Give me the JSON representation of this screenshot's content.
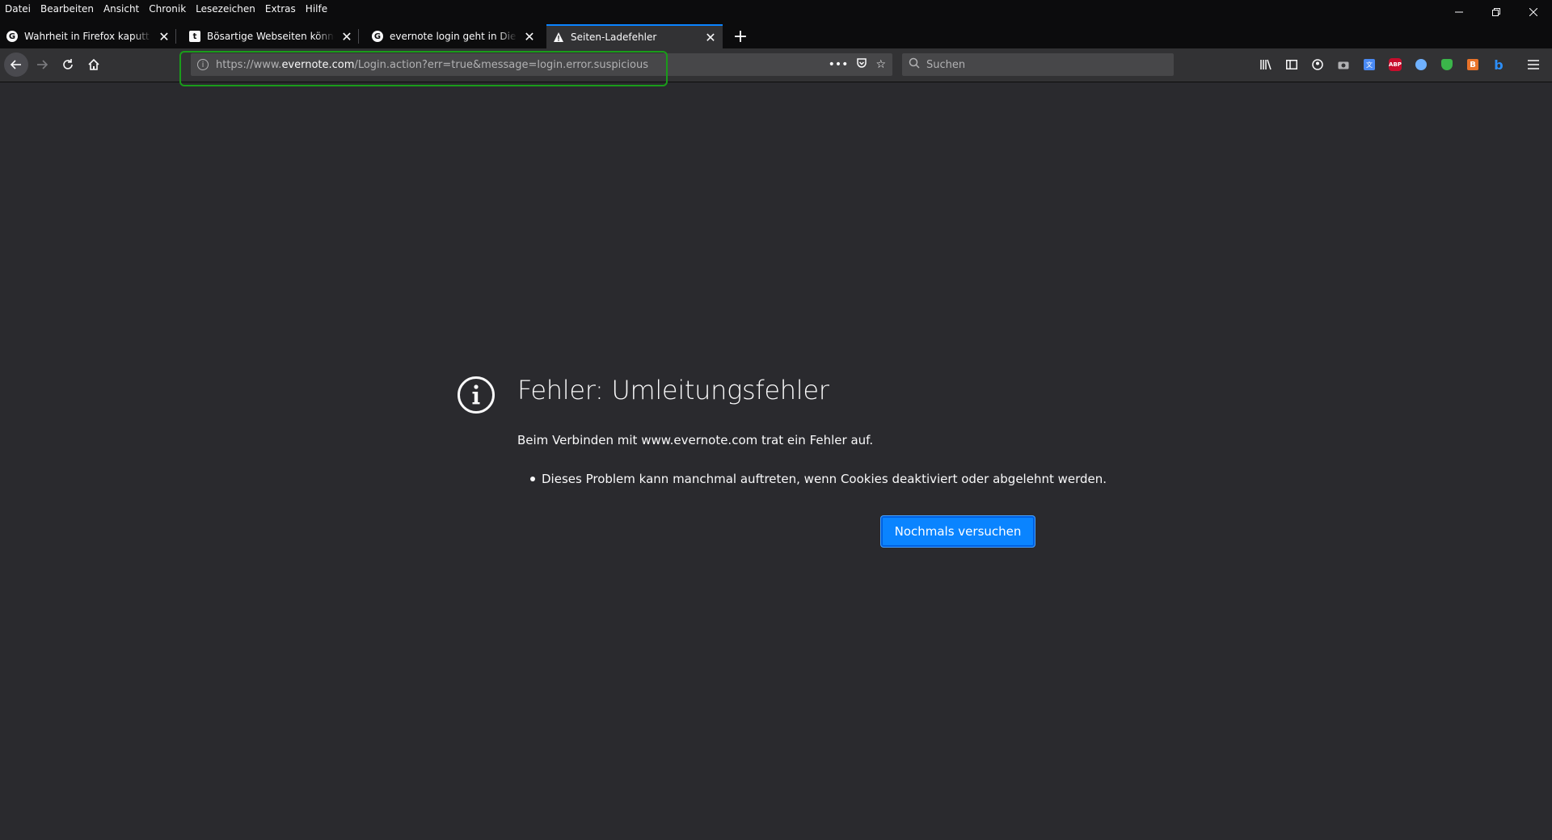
{
  "menubar": {
    "items": [
      "Datei",
      "Bearbeiten",
      "Ansicht",
      "Chronik",
      "Lesezeichen",
      "Extras",
      "Hilfe"
    ]
  },
  "tabs": [
    {
      "title": "Wahrheit in Firefox kaputt – Go",
      "icon": "google-icon",
      "active": false
    },
    {
      "title": "Bösartige Webseiten können m",
      "icon": "t-icon",
      "active": false
    },
    {
      "title": "evernote login geht in Die Wah",
      "icon": "google-icon",
      "active": false
    },
    {
      "title": "Seiten-Ladefehler",
      "icon": "warning-icon",
      "active": true
    }
  ],
  "urlbar": {
    "url_prefix": "https://www.",
    "url_domain": "evernote.com",
    "url_path": "/Login.action?err=true&message=login.error.suspicious"
  },
  "search": {
    "placeholder": "Suchen"
  },
  "error": {
    "title": "Fehler: Umleitungsfehler",
    "description": "Beim Verbinden mit www.evernote.com trat ein Fehler auf.",
    "items": [
      "Dieses Problem kann manchmal auftreten, wenn Cookies deaktiviert oder abgelehnt werden."
    ],
    "retry_label": "Nochmals versuchen"
  },
  "colors": {
    "accent": "#0a84ff",
    "background": "#2a2a2e",
    "highlight": "#1a9c1a"
  }
}
